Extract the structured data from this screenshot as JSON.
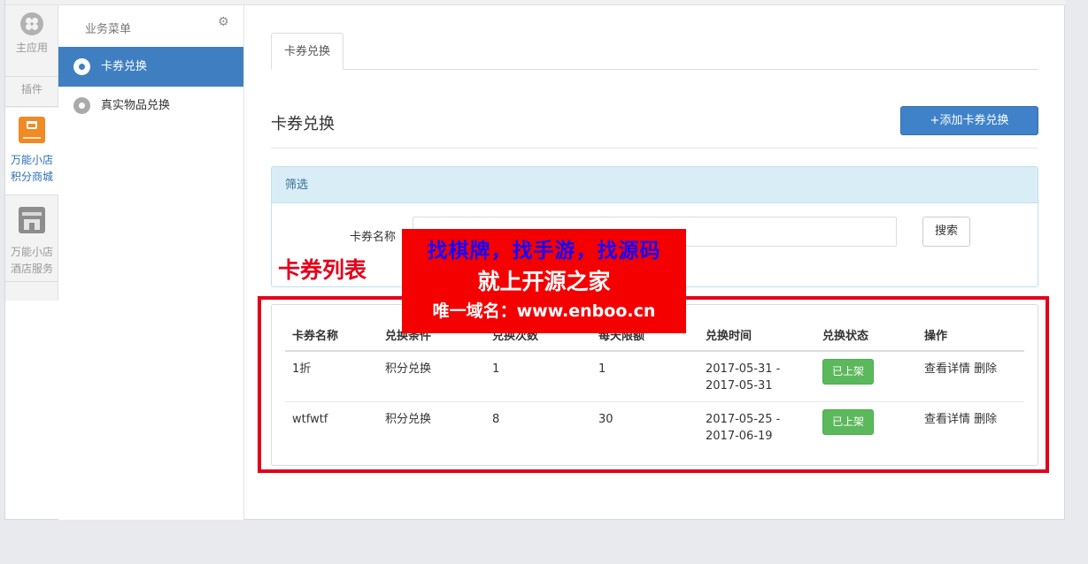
{
  "rail": {
    "main_label": "主应用",
    "plugin_label": "插件",
    "apps": [
      {
        "label_line1": "万能小店",
        "label_line2": "积分商城"
      },
      {
        "label_line1": "万能小店",
        "label_line2": "酒店服务"
      }
    ]
  },
  "submenu": {
    "title": "业务菜单",
    "items": [
      {
        "label": "卡券兑换"
      },
      {
        "label": "真实物品兑换"
      }
    ]
  },
  "tabs": [
    {
      "label": "卡券兑换"
    }
  ],
  "page": {
    "title": "卡券兑换",
    "add_button": "+添加卡券兑换"
  },
  "filter": {
    "heading": "筛选",
    "name_label": "卡券名称",
    "name_value": "",
    "search_button": "搜索"
  },
  "list": {
    "title": "卡券列表",
    "columns": [
      "卡券名称",
      "兑换条件",
      "兑换次数",
      "每天限额",
      "兑换时间",
      "兑换状态",
      "操作"
    ],
    "rows": [
      {
        "name": "1折",
        "condition": "积分兑换",
        "times": "1",
        "daily_limit": "1",
        "time_start": "2017-05-31 -",
        "time_end": "2017-05-31",
        "status": "已上架",
        "view": "查看详情",
        "delete": "删除"
      },
      {
        "name": "wtfwtf",
        "condition": "积分兑换",
        "times": "8",
        "daily_limit": "30",
        "time_start": "2017-05-25 -",
        "time_end": "2017-06-19",
        "status": "已上架",
        "view": "查看详情",
        "delete": "删除"
      }
    ]
  },
  "watermark": {
    "line1": "找棋牌，找手游，找源码",
    "line2": "就上开源之家",
    "line3": "唯一域名：www.enboo.cn"
  },
  "colors": {
    "primary": "#3f7fc1",
    "success": "#5cb85c",
    "highlight_red": "#e3001b",
    "info_bg": "#d9edf7"
  }
}
